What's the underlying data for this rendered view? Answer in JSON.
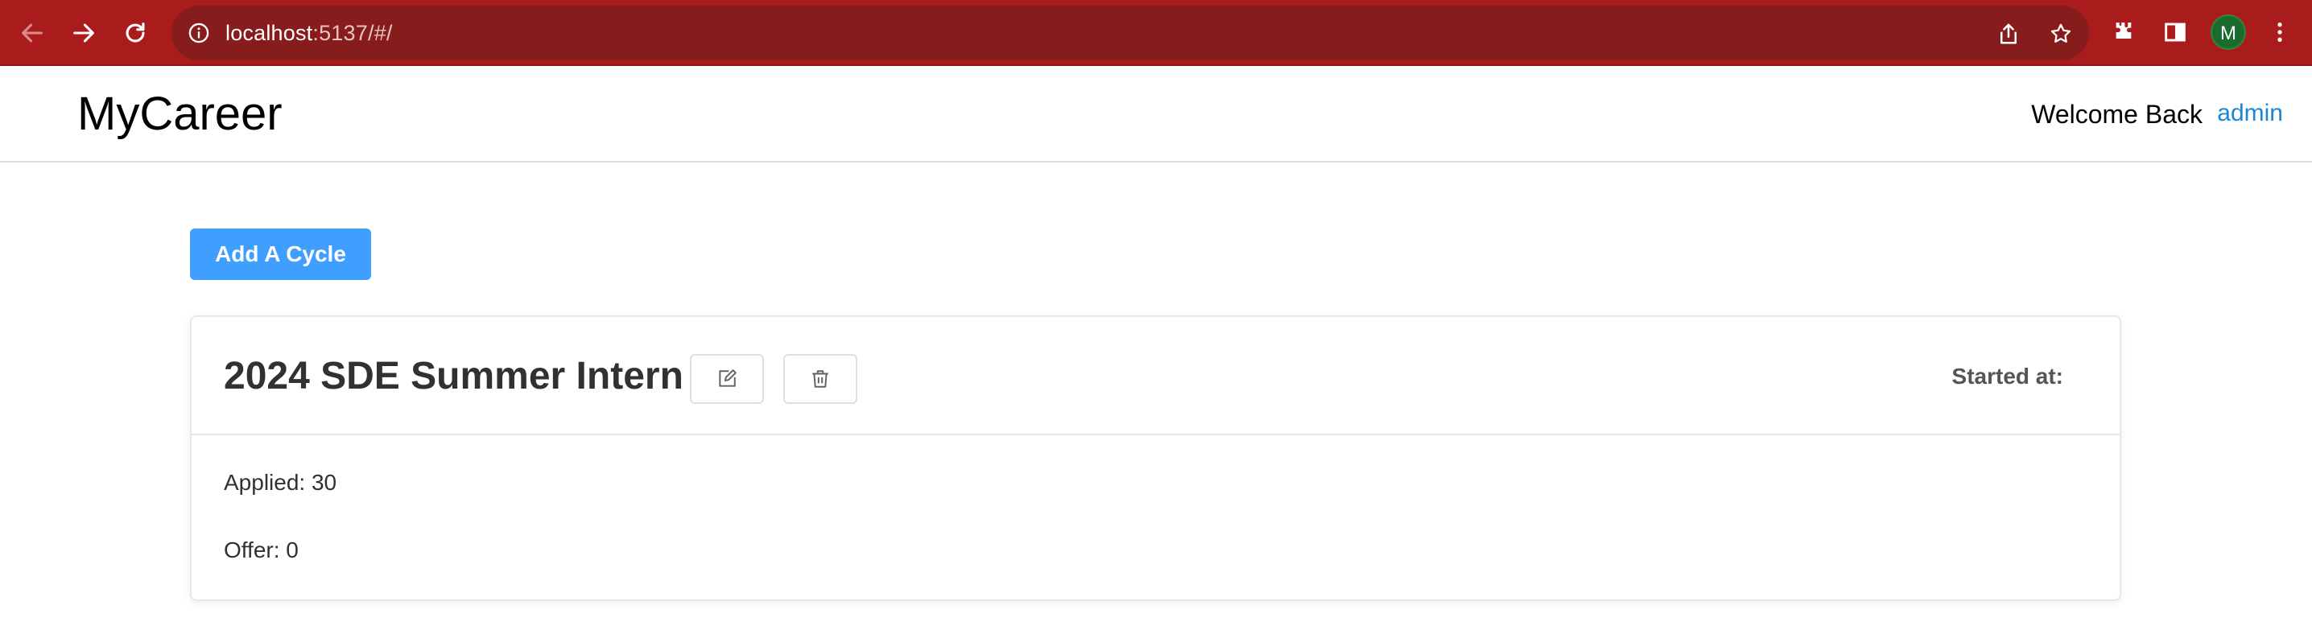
{
  "browser": {
    "url_host": "localhost",
    "url_rest": ":5137/#/",
    "profile_initial": "M",
    "colors": {
      "chrome": "#aa1c1c",
      "omnibox": "#861c1c"
    }
  },
  "header": {
    "brand": "MyCareer",
    "welcome": "Welcome Back",
    "username": "admin"
  },
  "main": {
    "add_cycle_label": "Add A Cycle",
    "cycles": [
      {
        "title": "2024 SDE Summer Intern",
        "started_at_label": "Started at:",
        "applied": "Applied: 30",
        "offer": "Offer: 0"
      }
    ]
  },
  "colors": {
    "primary": "#409eff",
    "link": "#1a86d6"
  }
}
